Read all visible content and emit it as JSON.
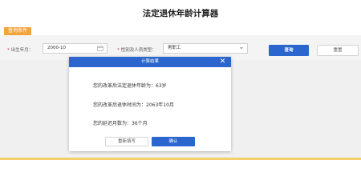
{
  "page": {
    "title": "法定退休年龄计算器"
  },
  "section": {
    "tag": "查询条件"
  },
  "form": {
    "birth": {
      "required_mark": "*",
      "label": "出生年月：",
      "value": "2000-10"
    },
    "category": {
      "required_mark": "*",
      "label": "性别及人员类型：",
      "value": "男职工"
    },
    "query_button": "查询",
    "reset_button": "重置"
  },
  "modal": {
    "title": "计算结果",
    "close_symbol": "✕",
    "lines": [
      "您的改革后法定退休年龄为：63岁",
      "您的改革后退休时间为：2063年10月",
      "您的延迟月数为：36个月"
    ],
    "refill_button": "重新填写",
    "confirm_button": "确认"
  },
  "colors": {
    "accent": "#2b66cf",
    "tag": "#f5a43c"
  }
}
